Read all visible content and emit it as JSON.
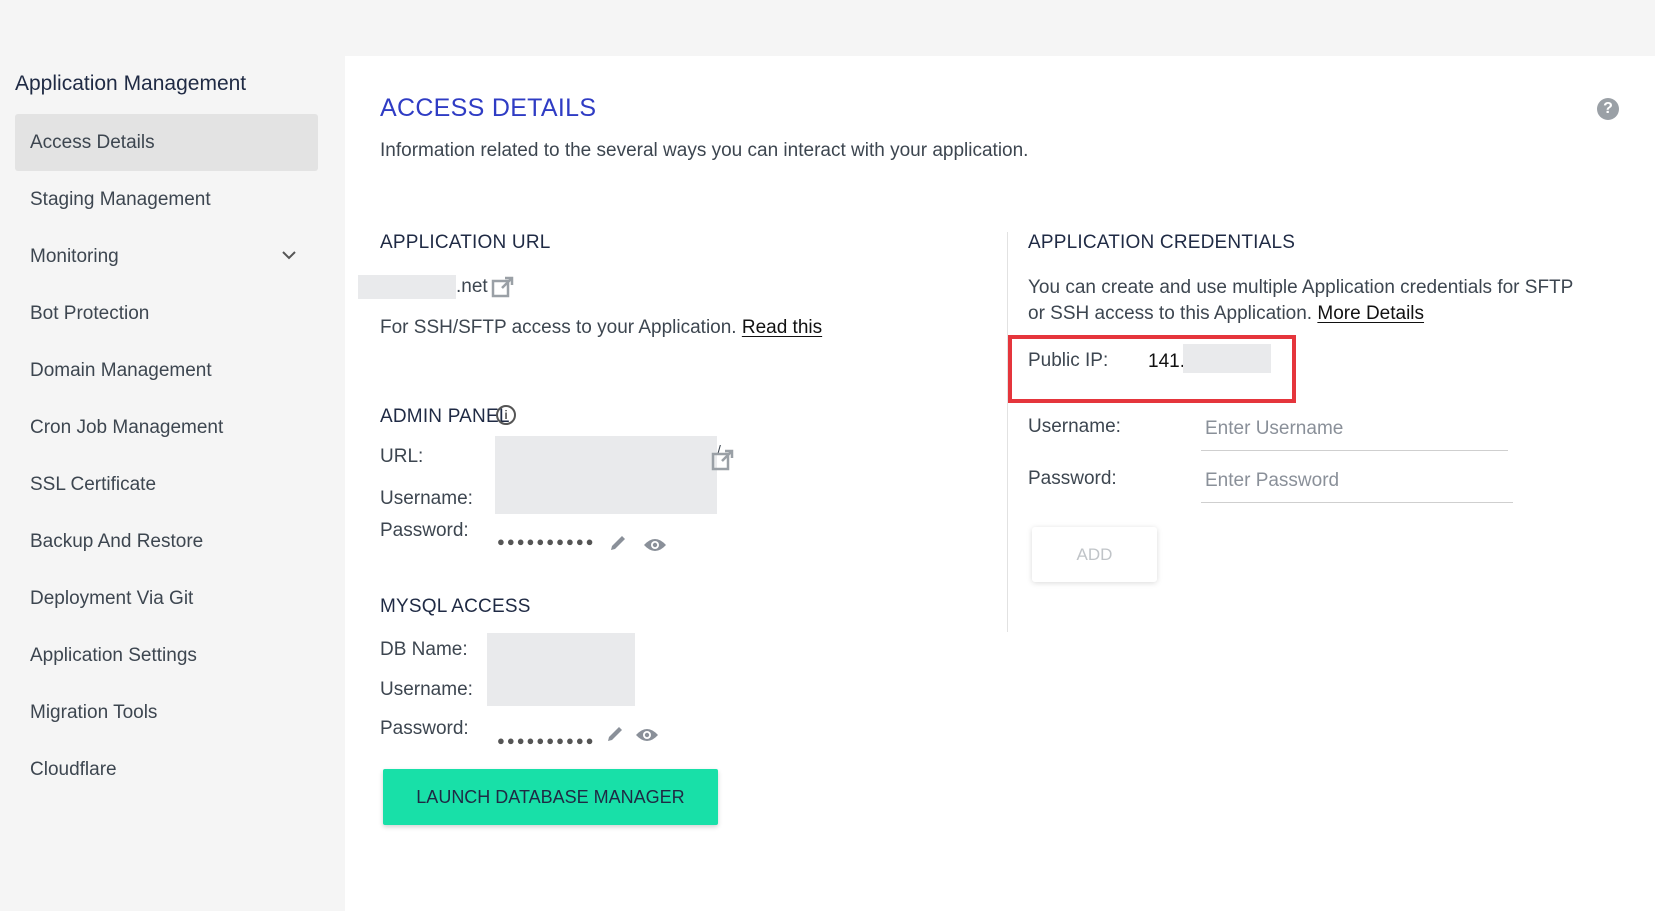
{
  "sidebar": {
    "title": "Application Management",
    "items": [
      {
        "label": "Access Details",
        "active": true
      },
      {
        "label": "Staging Management"
      },
      {
        "label": "Monitoring",
        "has_submenu": true
      },
      {
        "label": "Bot Protection"
      },
      {
        "label": "Domain Management"
      },
      {
        "label": "Cron Job Management"
      },
      {
        "label": "SSL Certificate"
      },
      {
        "label": "Backup And Restore"
      },
      {
        "label": "Deployment Via Git"
      },
      {
        "label": "Application Settings"
      },
      {
        "label": "Migration Tools"
      },
      {
        "label": "Cloudflare"
      }
    ]
  },
  "header": {
    "title": "ACCESS DETAILS",
    "subtitle": "Information related to the several ways you can interact with your application.",
    "help_icon": "question-circle-icon"
  },
  "app_url": {
    "title": "APPLICATION URL",
    "url_suffix": ".net",
    "ssh_note": "For SSH/SFTP access to your Application.",
    "read_link": "Read this"
  },
  "admin_panel": {
    "title": "ADMIN PANEL",
    "url_label": "URL:",
    "url_trail": "/",
    "username_label": "Username:",
    "password_label": "Password:",
    "password_mask": "●●●●●●●●●●"
  },
  "mysql": {
    "title": "MYSQL ACCESS",
    "db_label": "DB Name:",
    "username_label": "Username:",
    "password_label": "Password:",
    "password_mask": "●●●●●●●●●●",
    "launch_label": "LAUNCH DATABASE MANAGER"
  },
  "credentials": {
    "title": "APPLICATION CREDENTIALS",
    "desc_line1": "You can create and use multiple Application credentials for SFTP",
    "desc_line2": "or SSH access to this Application.",
    "more_link": "More Details",
    "public_ip_label": "Public IP:",
    "public_ip_value": "141.1",
    "username_label": "Username:",
    "username_placeholder": "Enter Username",
    "password_label": "Password:",
    "password_placeholder": "Enter Password",
    "add_label": "ADD"
  },
  "colors": {
    "title_blue": "#2f3cc4",
    "launch_green": "#18e0a8",
    "highlight_red": "#e5353c"
  }
}
